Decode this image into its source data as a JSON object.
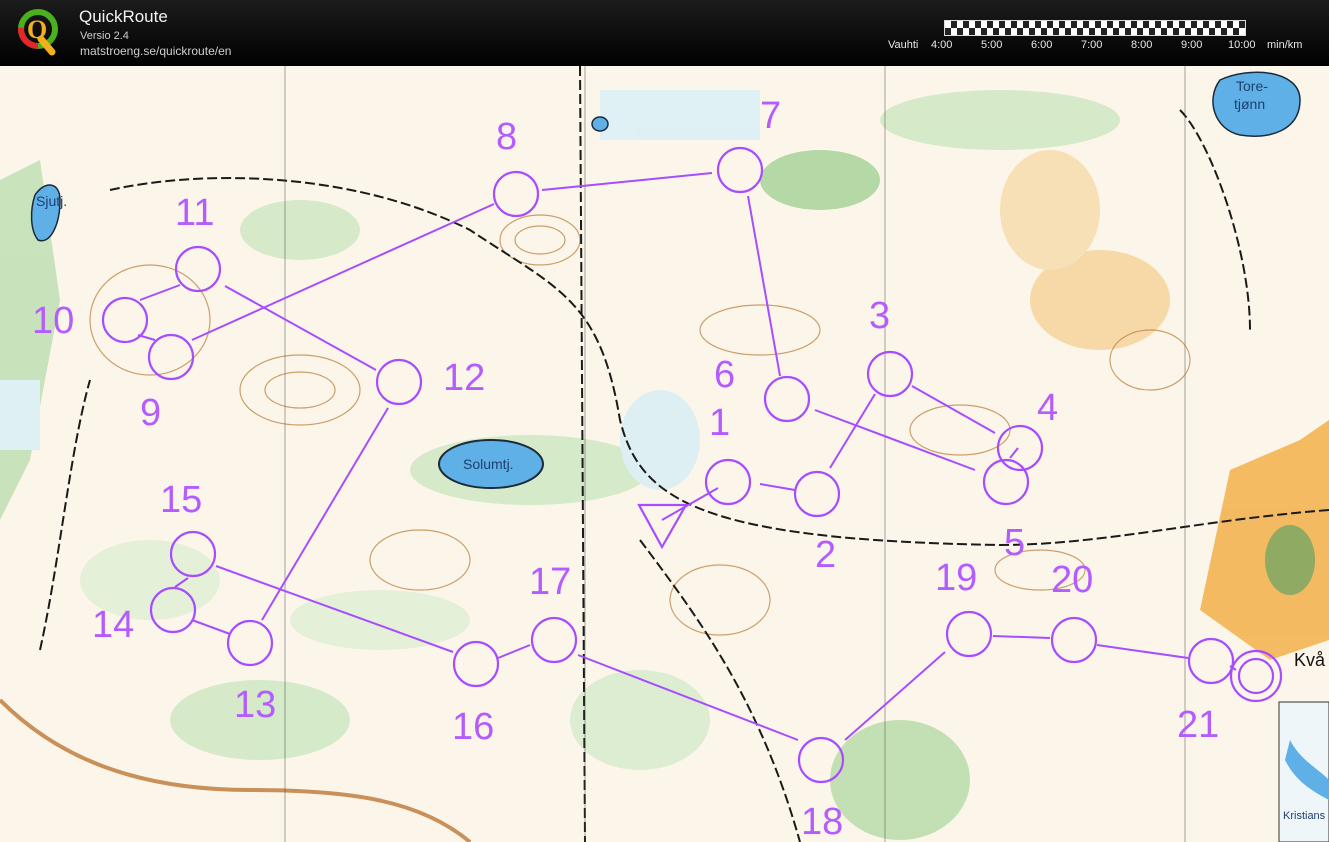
{
  "app": {
    "name": "QuickRoute",
    "version": "Versio 2.4",
    "url": "matstroeng.se/quickroute/en"
  },
  "pace_legend": {
    "label": "Vauhti",
    "ticks": [
      "4:00",
      "5:00",
      "6:00",
      "7:00",
      "8:00",
      "9:00",
      "10:00"
    ],
    "unit": "min/km"
  },
  "map": {
    "place_names": [
      "Sjutj.",
      "Solumtj.",
      "Tore-",
      "tjønn",
      "Kvå",
      "Kristians"
    ],
    "course": {
      "color": "#a64dff",
      "controls": [
        "1",
        "2",
        "3",
        "4",
        "5",
        "6",
        "7",
        "8",
        "9",
        "10",
        "11",
        "12",
        "13",
        "14",
        "15",
        "16",
        "17",
        "18",
        "19",
        "20",
        "21"
      ]
    }
  }
}
